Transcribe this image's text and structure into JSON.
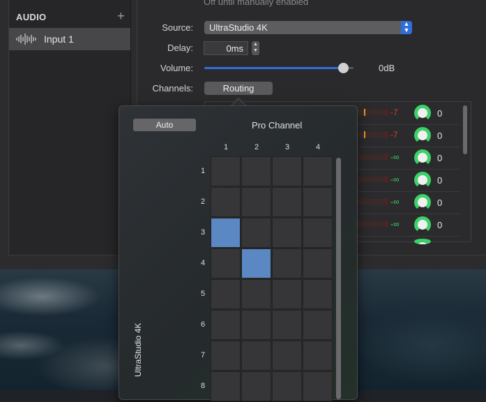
{
  "sidebar": {
    "top_partial": "",
    "section_title": "AUDIO",
    "add_label": "+",
    "items": [
      {
        "label": "Input 1",
        "icon": "waveform-icon"
      }
    ]
  },
  "panel": {
    "cut_text": "Off until manually enabled",
    "source": {
      "label": "Source:",
      "value": "UltraStudio 4K"
    },
    "delay": {
      "label": "Delay:",
      "value": "0ms"
    },
    "volume": {
      "label": "Volume:",
      "value": "0dB",
      "level": 0.93
    },
    "channels": {
      "label": "Channels:",
      "button": "Routing",
      "rows": [
        {
          "db": "-7",
          "db_color": "#e0363a",
          "knob": "0"
        },
        {
          "db": "-7",
          "db_color": "#e0363a",
          "knob": "0"
        },
        {
          "db": "-∞",
          "db_color": "#3dd16a",
          "knob": "0"
        },
        {
          "db": "-∞",
          "db_color": "#3dd16a",
          "knob": "0"
        },
        {
          "db": "-∞",
          "db_color": "#3dd16a",
          "knob": "0"
        },
        {
          "db": "-∞",
          "db_color": "#3dd16a",
          "knob": "0"
        }
      ]
    }
  },
  "routing": {
    "auto_label": "Auto",
    "title": "Pro Channel",
    "columns": [
      "1",
      "2",
      "3",
      "4"
    ],
    "rows": [
      "1",
      "2",
      "3",
      "4",
      "5",
      "6",
      "7",
      "8"
    ],
    "device_label": "UltraStudio 4K",
    "selected": [
      {
        "row": 3,
        "col": 1
      },
      {
        "row": 4,
        "col": 2
      }
    ]
  },
  "colors": {
    "accent": "#2f6fdc",
    "selected_cell": "#5b88c2",
    "knob_green": "#3dd16a",
    "clip_red": "#e0363a"
  }
}
